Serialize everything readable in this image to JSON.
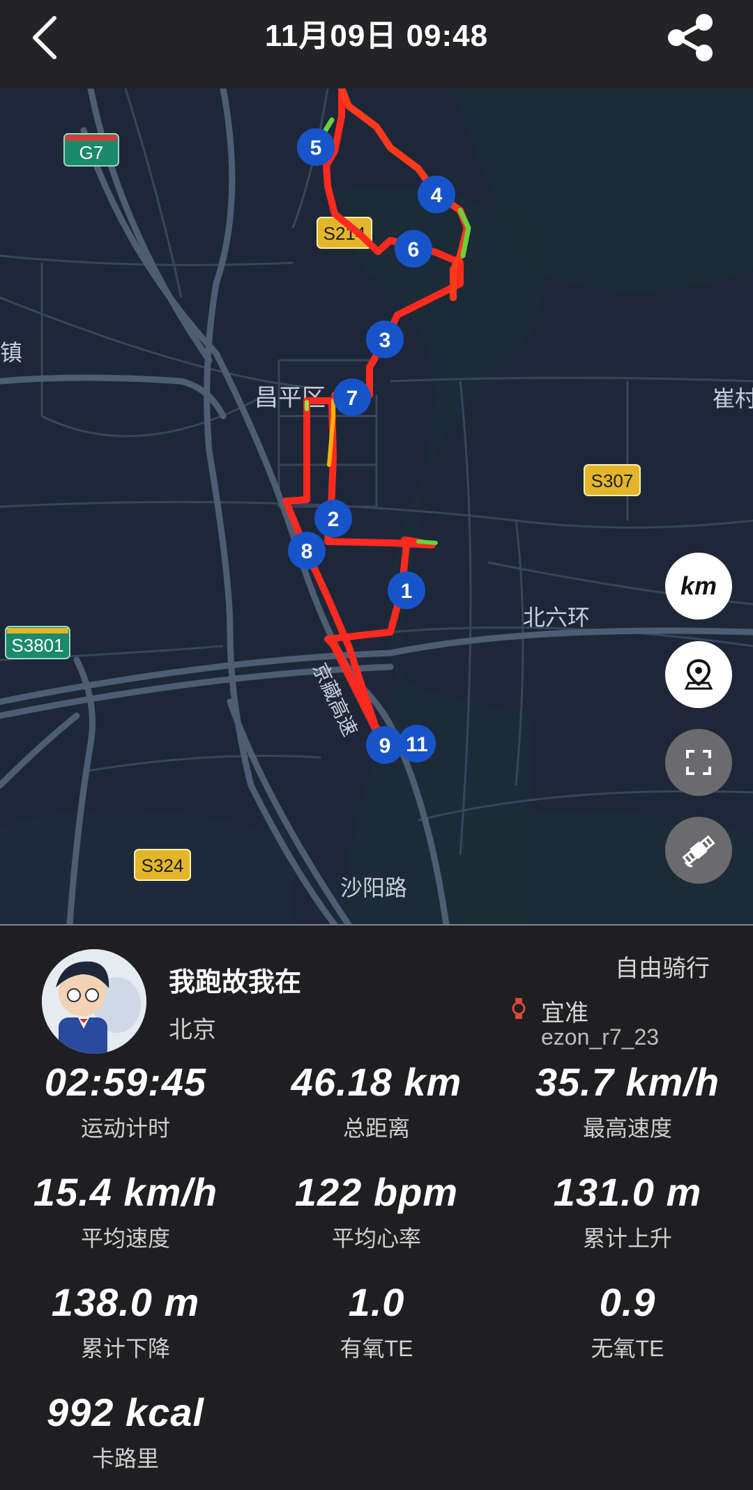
{
  "header": {
    "title": "11月09日 09:48"
  },
  "map": {
    "labels": {
      "changping": "昌平区",
      "beiliuhuan": "北六环",
      "shayanglu": "沙阳路",
      "zhen": "镇",
      "cui": "崔村",
      "jingzang": "京藏高速"
    },
    "shields": {
      "g7": "G7",
      "s214": "S214",
      "s307": "S307",
      "s3801": "S3801",
      "s324": "S324"
    },
    "km_markers": [
      "1",
      "2",
      "3",
      "4",
      "5",
      "6",
      "7",
      "8",
      "9",
      "11"
    ],
    "controls": {
      "unit_label": "km",
      "unit_icon": "km-toggle",
      "location_icon": "location-pin-icon",
      "fullscreen_icon": "fullscreen-icon",
      "satellite_icon": "satellite-icon"
    },
    "route_colors": {
      "primary": "#ff2a1f",
      "mid": "#ff8a00",
      "low": "#52d13c"
    }
  },
  "profile": {
    "name": "我跑故我在",
    "city": "北京",
    "activity_type": "自由骑行",
    "device_brand": "宜准",
    "device_id": "ezon_r7_23"
  },
  "stats": [
    {
      "value": "02:59:45",
      "label": "运动计时"
    },
    {
      "value": "46.18 km",
      "label": "总距离"
    },
    {
      "value": "35.7 km/h",
      "label": "最高速度"
    },
    {
      "value": "15.4 km/h",
      "label": "平均速度"
    },
    {
      "value": "122 bpm",
      "label": "平均心率"
    },
    {
      "value": "131.0 m",
      "label": "累计上升"
    },
    {
      "value": "138.0 m",
      "label": "累计下降"
    },
    {
      "value": "1.0",
      "label": "有氧TE"
    },
    {
      "value": "0.9",
      "label": "无氧TE"
    },
    {
      "value": "992 kcal",
      "label": "卡路里"
    }
  ]
}
